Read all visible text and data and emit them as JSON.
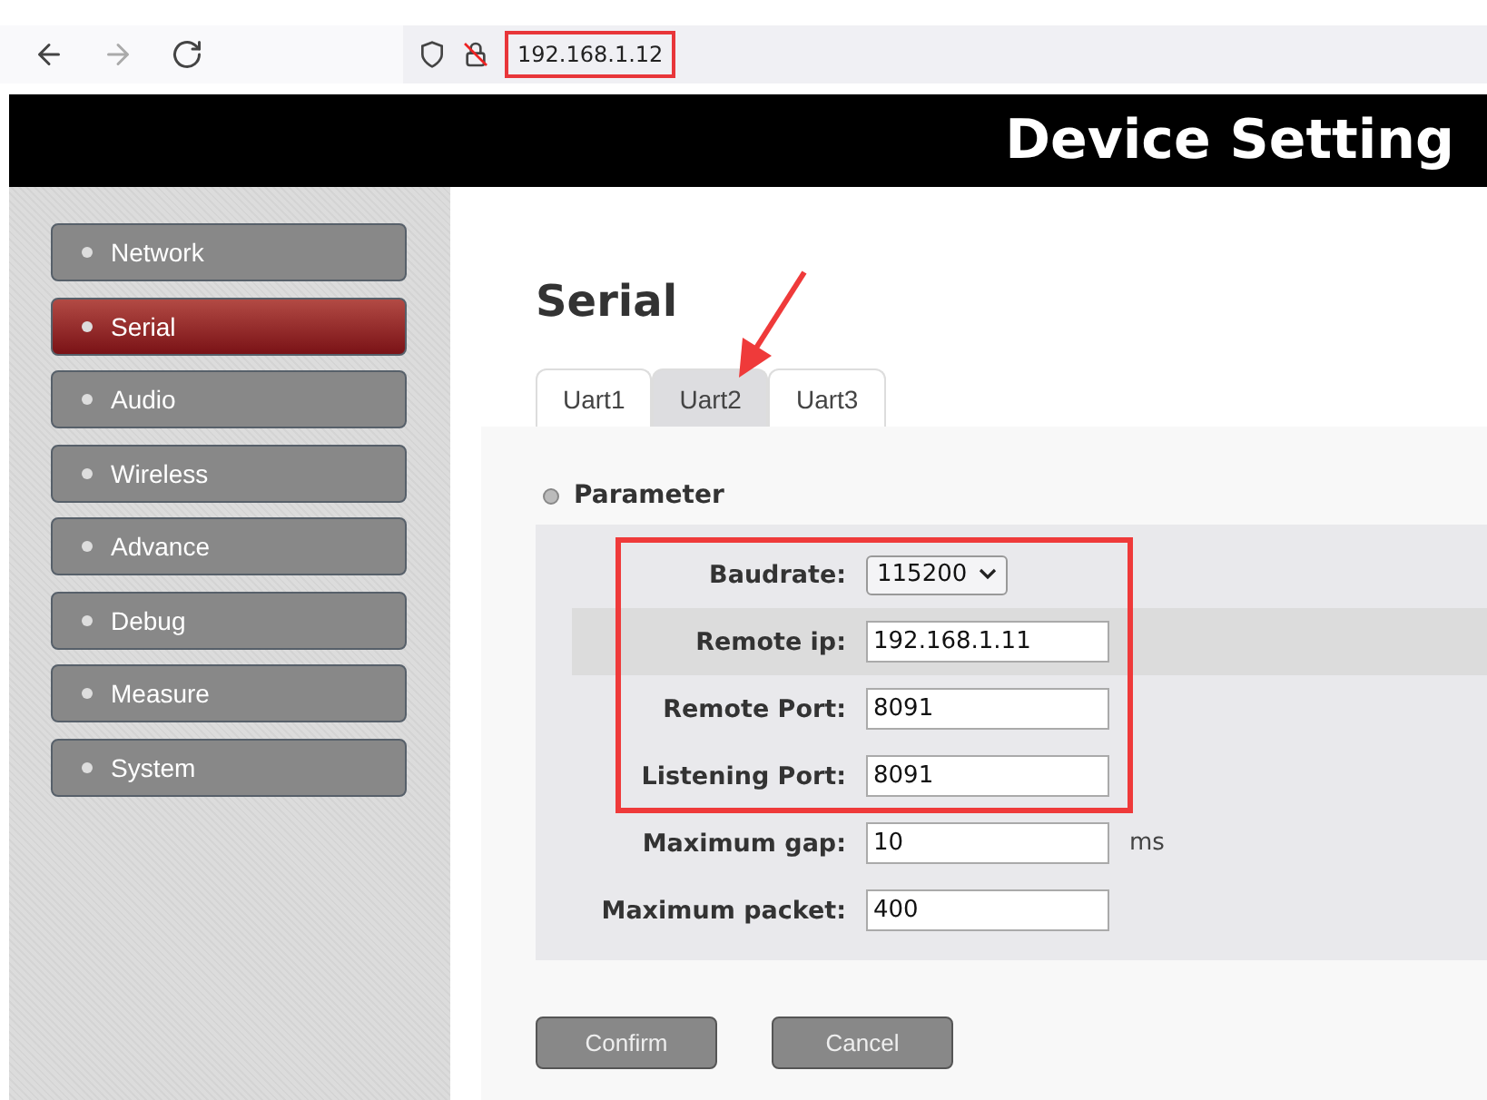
{
  "browser": {
    "url": "192.168.1.12",
    "url_annotated": true,
    "forward_disabled": true
  },
  "header": {
    "title": "Device Setting"
  },
  "sidebar": {
    "items": [
      {
        "label": "Network",
        "selected": false
      },
      {
        "label": "Serial",
        "selected": true
      },
      {
        "label": "Audio",
        "selected": false
      },
      {
        "label": "Wireless",
        "selected": false
      },
      {
        "label": "Advance",
        "selected": false
      },
      {
        "label": "Debug",
        "selected": false
      },
      {
        "label": "Measure",
        "selected": false
      },
      {
        "label": "System",
        "selected": false
      }
    ]
  },
  "page": {
    "title": "Serial"
  },
  "tabs": [
    {
      "label": "Uart1",
      "selected": false
    },
    {
      "label": "Uart2",
      "selected": true
    },
    {
      "label": "Uart3",
      "selected": false
    }
  ],
  "section": {
    "title": "Parameter"
  },
  "fields": [
    {
      "label": "Baudrate:",
      "kind": "select",
      "value": "115200",
      "highlighted": false,
      "annotated": true
    },
    {
      "label": "Remote ip:",
      "kind": "text",
      "value": "192.168.1.11",
      "highlighted": true,
      "annotated": true
    },
    {
      "label": "Remote Port:",
      "kind": "text",
      "value": "8091",
      "highlighted": false,
      "annotated": true
    },
    {
      "label": "Listening Port:",
      "kind": "text",
      "value": "8091",
      "highlighted": false,
      "annotated": true
    },
    {
      "label": "Maximum gap:",
      "kind": "text",
      "value": "10",
      "unit": "ms",
      "highlighted": false,
      "annotated": false
    },
    {
      "label": "Maximum packet:",
      "kind": "text",
      "value": "400",
      "highlighted": false,
      "annotated": false
    }
  ],
  "buttons": [
    "Confirm",
    "Cancel"
  ]
}
